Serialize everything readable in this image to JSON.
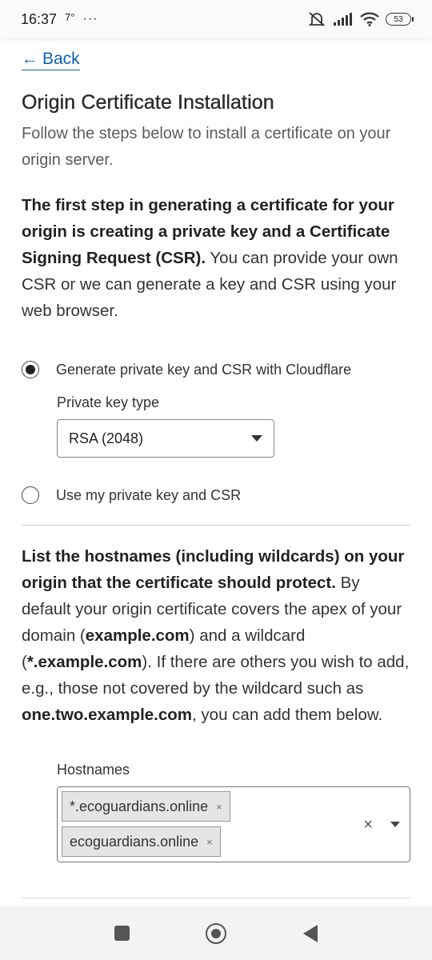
{
  "status_bar": {
    "time": "16:37",
    "temperature": "7°",
    "more": "···",
    "battery": "53",
    "icons": [
      "mute-icon",
      "signal-icon",
      "wifi-icon",
      "battery-icon"
    ]
  },
  "back": {
    "arrow": "←",
    "label": "Back"
  },
  "title": "Origin Certificate Installation",
  "subtitle": "Follow the steps below to install a certificate on your origin server.",
  "intro": {
    "bold": "The first step in generating a certificate for your origin is creating a private key and a Certificate Signing Request (CSR).",
    "rest": " You can provide your own CSR or we can generate a key and CSR using your web browser."
  },
  "options": {
    "generate": {
      "label": "Generate private key and CSR with Cloudflare",
      "selected": true
    },
    "key_type_label": "Private key type",
    "key_type_value": "RSA (2048)",
    "own": {
      "label": "Use my private key and CSR",
      "selected": false
    }
  },
  "hostnames_info": {
    "bold": "List the hostnames (including wildcards) on your origin that the certificate should protect.",
    "t1": " By default your origin certificate covers the apex of your domain (",
    "b1": "example.com",
    "t2": ") and a wildcard (",
    "b2": "*.example.com",
    "t3": "). If there are others you wish to add, e.g., those not covered by the wildcard such as ",
    "b3": "one.two.example.com",
    "t4": ", you can add them below."
  },
  "hostnames": {
    "label": "Hostnames",
    "tags": [
      "*.ecoguardians.online",
      "ecoguardians.online"
    ],
    "tag_remove": "×",
    "clear": "×"
  },
  "colors": {
    "link": "#0b62b2",
    "text": "#333333"
  }
}
